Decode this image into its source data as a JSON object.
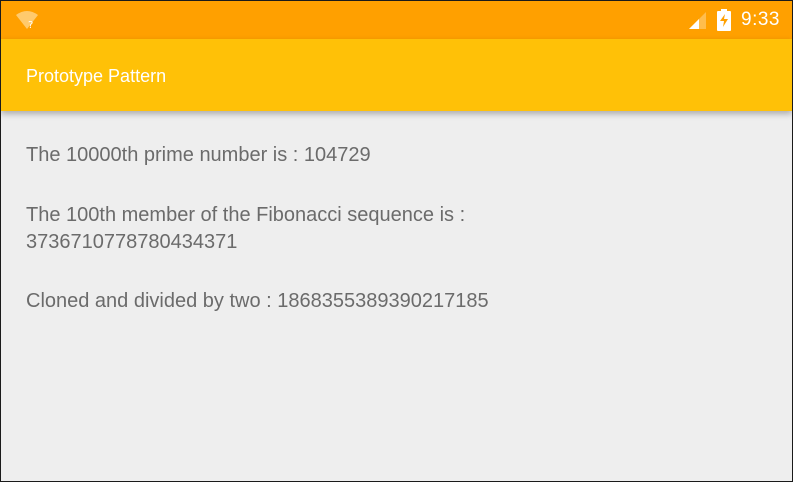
{
  "status_bar": {
    "time": "9:33",
    "wifi_icon": "wifi-no-internet-icon",
    "signal_icon": "cellular-signal-icon",
    "battery_icon": "battery-charging-icon",
    "color": "#ffa000"
  },
  "app_bar": {
    "title": "Prototype Pattern",
    "color": "#ffc107"
  },
  "content": {
    "line1": "The 10000th prime number is : 104729",
    "line2": "The 100th member of the Fibonacci sequence is : 3736710778780434371",
    "line3": "Cloned and divided by two : 1868355389390217185"
  }
}
